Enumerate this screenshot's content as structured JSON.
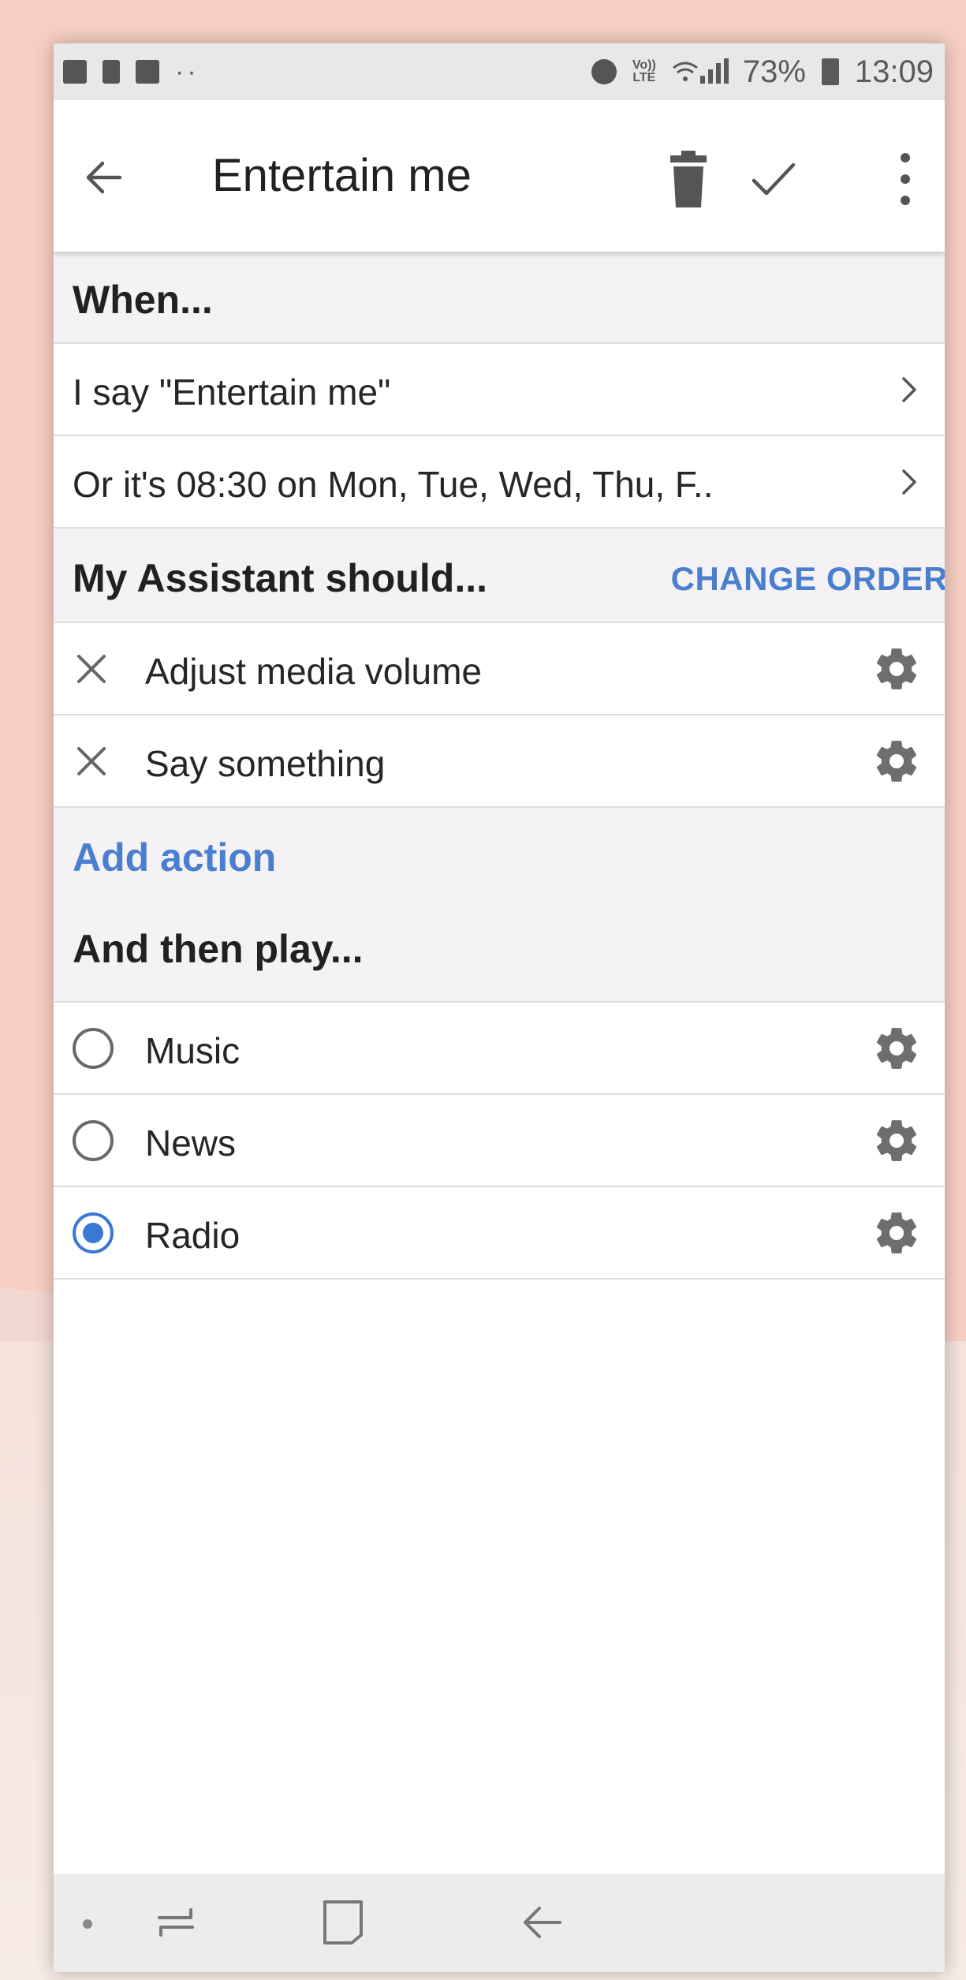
{
  "status_bar": {
    "notification_dots": "··",
    "volte": "Vo)) LTE",
    "battery": "73%",
    "time": "13:09"
  },
  "toolbar": {
    "title": "Entertain me"
  },
  "when_section": {
    "heading": "When...",
    "triggers": [
      {
        "label": "I say \"Entertain me\""
      },
      {
        "label": "Or it's 08:30 on Mon, Tue, Wed, Thu, F.."
      }
    ]
  },
  "assistant_section": {
    "heading": "My Assistant should...",
    "change_order_label": "CHANGE ORDER",
    "actions": [
      {
        "label": "Adjust media volume"
      },
      {
        "label": "Say something"
      }
    ],
    "add_action_label": "Add action"
  },
  "play_section": {
    "heading": "And then play...",
    "options": [
      {
        "label": "Music",
        "selected": false
      },
      {
        "label": "News",
        "selected": false
      },
      {
        "label": "Radio",
        "selected": true
      }
    ]
  },
  "colors": {
    "accent": "#4a7fcf",
    "radio_selected": "#3b78d4",
    "section_bg": "#f4f2f4",
    "background_pink": "#f6cfc2"
  },
  "icons": [
    "back-arrow-icon",
    "trash-icon",
    "check-icon",
    "more-vert-icon",
    "chevron-right-icon",
    "close-icon",
    "gear-icon",
    "radio-button-icon",
    "recent-apps-icon",
    "home-icon",
    "nav-back-icon"
  ]
}
